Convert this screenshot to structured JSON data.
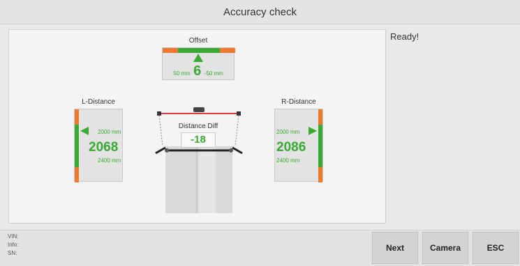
{
  "header": {
    "title": "Accuracy check"
  },
  "status": {
    "text": "Ready!"
  },
  "offset": {
    "label": "Offset",
    "left_limit": "50 mm",
    "value": "6",
    "right_limit": "-50 mm"
  },
  "left_distance": {
    "label": "L-Distance",
    "min": "2000 mm",
    "value": "2068",
    "max": "2400 mm"
  },
  "right_distance": {
    "label": "R-Distance",
    "min": "2000 mm",
    "value": "2086",
    "max": "2400 mm"
  },
  "distance_diff": {
    "label": "Distance Diff",
    "value": "-18"
  },
  "info": {
    "vin": "VIN:",
    "info": "Info:",
    "sn": "SN:"
  },
  "buttons": {
    "next": "Next",
    "camera": "Camera",
    "esc": "ESC"
  },
  "colors": {
    "ok_green": "#3aaa35",
    "warn_orange": "#ee7a2f",
    "beam_red": "#e03b3b"
  },
  "icons": {
    "offset_pointer": "triangle-up-icon",
    "left_pointer": "triangle-right-icon",
    "right_pointer": "triangle-left-icon"
  }
}
